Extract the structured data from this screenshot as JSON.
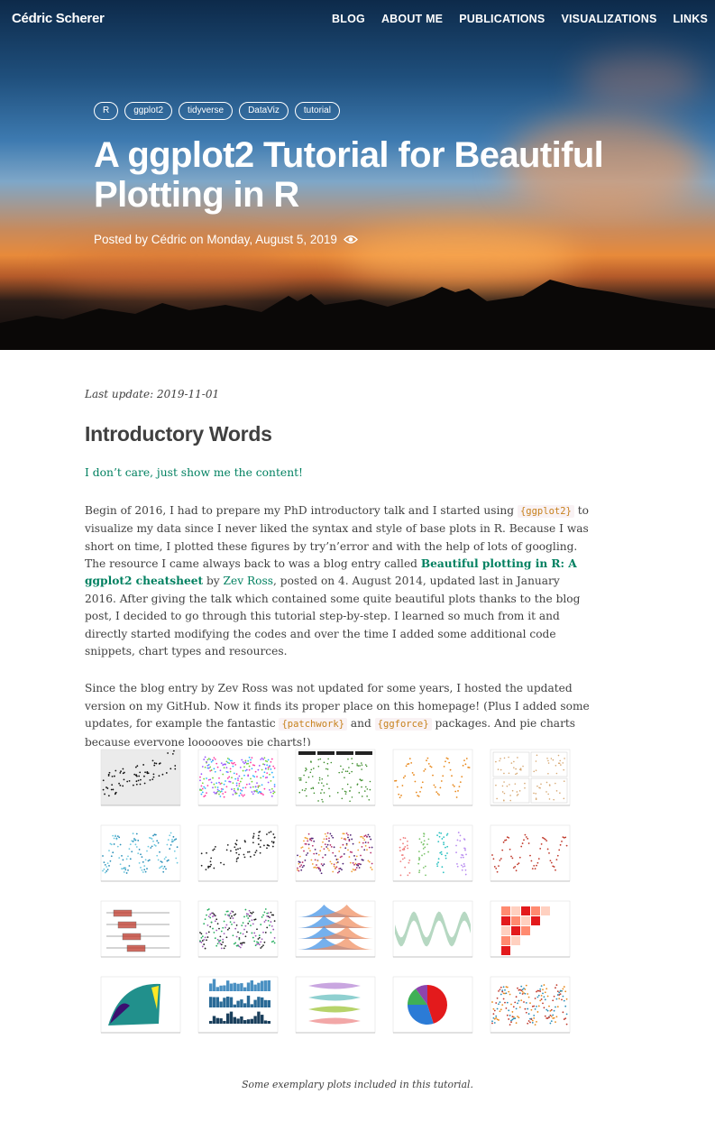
{
  "site": {
    "brand": "Cédric Scherer"
  },
  "nav": {
    "items": [
      "BLOG",
      "ABOUT ME",
      "PUBLICATIONS",
      "VISUALIZATIONS",
      "LINKS"
    ]
  },
  "post": {
    "tags": [
      "R",
      "ggplot2",
      "tidyverse",
      "DataViz",
      "tutorial"
    ],
    "title": "A ggplot2 Tutorial for Beautiful Plotting in R",
    "meta": "Posted by Cédric on Monday, August 5, 2019"
  },
  "content": {
    "last_update": "Last update: 2019-11-01",
    "section_title": "Introductory Words",
    "skip_link": "I don’t care, just show me the content!",
    "p1": {
      "t1": "Begin of 2016, I had to prepare my PhD introductory talk and I started using ",
      "code1": "{ggplot2}",
      "t2": " to visualize my data since I never liked the syntax and style of base plots in R. Because I was short on time, I plotted these figures by try’n’error and with the help of lots of googling. The resource I came always back to was a blog entry called ",
      "link1": "Beautiful plotting in R: A ggplot2 cheatsheet",
      "t3": " by ",
      "link2": "Zev Ross",
      "t4": ", posted on 4. August 2014, updated last in January 2016. After giving the talk which contained some quite beautiful plots thanks to the blog post, I decided to go through this tutorial step-by-step. I learned so much from it and directly started modifying the codes and over the time I added some additional code snippets, chart types and resources."
    },
    "p2": {
      "t1": "Since the blog entry by Zev Ross was not updated for some years, I hosted the updated version on my GitHub. Now it finds its proper place on this homepage! (Plus I added some updates, for example the fantastic ",
      "code1": "{patchwork}",
      "t2": " and ",
      "code2": "{ggforce}",
      "t3": " packages. And pie charts because everyone loooooves pie charts!)"
    },
    "caption": "Some exemplary plots included in this tutorial."
  },
  "gallery": {
    "thumbs": [
      {
        "name": "scatter-gray-thumb",
        "kind": "scatter",
        "colors": [
          "#111111"
        ],
        "bg": "#ebebeb"
      },
      {
        "name": "rainbow-lines-thumb",
        "kind": "wave",
        "colors": [
          "#ff3fa4",
          "#2fb3ff",
          "#7bd23c",
          "#9a55ff"
        ],
        "bg": "#ffffff"
      },
      {
        "name": "facet-green-thumb",
        "kind": "strips",
        "colors": [
          "#3c8c2a"
        ],
        "bg": "#ffffff"
      },
      {
        "name": "orange-points-thumb",
        "kind": "wave",
        "colors": [
          "#e8891d"
        ],
        "bg": "#ffffff"
      },
      {
        "name": "facet-grid-thumb",
        "kind": "grid4",
        "colors": [
          "#d7a872"
        ],
        "bg": "#ffffff"
      },
      {
        "name": "teal-lines-thumb",
        "kind": "wave",
        "colors": [
          "#2a8fb8",
          "#6cc9e0"
        ],
        "bg": "#ffffff"
      },
      {
        "name": "regression-thumb",
        "kind": "scatter",
        "colors": [
          "#222222"
        ],
        "bg": "#ffffff"
      },
      {
        "name": "viridis-thumb",
        "kind": "wave",
        "colors": [
          "#4b1f73",
          "#b8316c",
          "#f1a33a"
        ],
        "bg": "#ffffff"
      },
      {
        "name": "jitter-thumb",
        "kind": "jitter",
        "colors": [
          "#f08080",
          "#7cc46c",
          "#2bc1c1",
          "#b88bf0"
        ],
        "bg": "#ffffff"
      },
      {
        "name": "red-points-thumb",
        "kind": "wave",
        "colors": [
          "#c0392b"
        ],
        "bg": "#ffffff"
      },
      {
        "name": "boxplot-thumb",
        "kind": "box",
        "colors": [
          "#c0392b"
        ],
        "bg": "#ffffff"
      },
      {
        "name": "labels-thumb",
        "kind": "wave",
        "colors": [
          "#222222",
          "#9b59b6",
          "#27ae60"
        ],
        "bg": "#ffffff"
      },
      {
        "name": "ridgeline-thumb",
        "kind": "ridge",
        "colors": [
          "#3a8ee6",
          "#f08a5a"
        ],
        "bg": "#ffffff"
      },
      {
        "name": "green-band-thumb",
        "kind": "band",
        "colors": [
          "#2f8f4f"
        ],
        "bg": "#ffffff"
      },
      {
        "name": "heatmap-thumb",
        "kind": "heat",
        "colors": [
          "#e31a1c",
          "#ff8a70",
          "#ffd0c0"
        ],
        "bg": "#ffffff"
      },
      {
        "name": "contour-thumb",
        "kind": "contour",
        "colors": [
          "#3b0f70",
          "#21908c",
          "#fde725"
        ],
        "bg": "#ffffff"
      },
      {
        "name": "histogram-thumb",
        "kind": "hist",
        "colors": [
          "#4a90c2",
          "#2a6a96",
          "#1a3f5c"
        ],
        "bg": "#ffffff"
      },
      {
        "name": "violin-thumb",
        "kind": "violin",
        "colors": [
          "#c9a6e0",
          "#8fd0d0",
          "#b7d36a",
          "#f2a7a7"
        ],
        "bg": "#ffffff"
      },
      {
        "name": "pie-thumb",
        "kind": "pie",
        "colors": [
          "#e31a1c",
          "#2b7bd6",
          "#3fb055",
          "#8e44ad"
        ],
        "bg": "#ffffff"
      },
      {
        "name": "multi-lines-thumb",
        "kind": "wave",
        "colors": [
          "#e8891d",
          "#2a8fb8",
          "#c0392b"
        ],
        "bg": "#ffffff"
      }
    ]
  }
}
